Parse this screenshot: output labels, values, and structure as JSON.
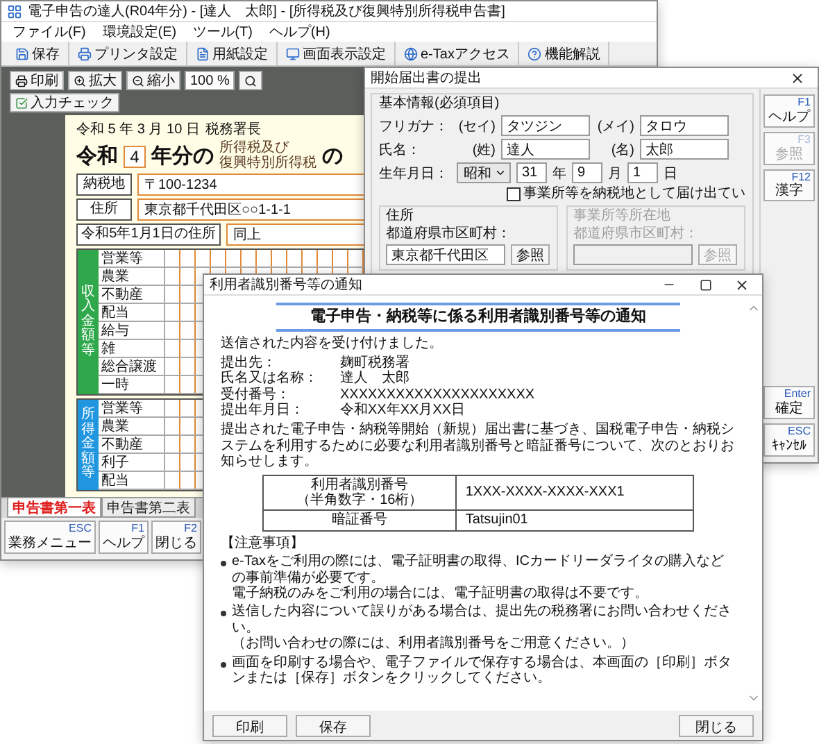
{
  "main_window": {
    "title": "電子申告の達人(R04年分) - [達人　太郎] - [所得税及び復興特別所得税申告書]",
    "menu": [
      "ファイル(F)",
      "環境設定(E)",
      "ツール(T)",
      "ヘルプ(H)"
    ],
    "toolbar": [
      "保存",
      "プリンタ設定",
      "用紙設定",
      "画面表示設定",
      "e-Taxアクセス",
      "機能解説"
    ],
    "view_buttons": [
      "印刷",
      "拡大",
      "縮小"
    ],
    "zoom": "100 %",
    "check_button": "入力チェック",
    "form": {
      "date": "令和 5 年 3 月 10 日",
      "office": "税務署長",
      "era": "令和",
      "year": "4",
      "year_suffix": "年分の",
      "tax_name": [
        "所得税及び",
        "復興特別所得税"
      ],
      "title_end": "の",
      "postal_label": "納税地",
      "postal_code": "〒100-1234",
      "address_label": "住所",
      "address": "東京都千代田区○○1-1-1",
      "prev_label": "令和5年1月1日の住所",
      "prev_address": "同上",
      "sections": [
        {
          "label": "収入金額等",
          "color": "#2ea84a",
          "rows": [
            "営業等",
            "農業",
            "不動産",
            "配当",
            "給与",
            "雑",
            "総合譲渡",
            "一時"
          ]
        },
        {
          "label": "所得金額等",
          "color": "#2196e0",
          "rows": [
            "営業等",
            "農業",
            "不動産",
            "利子",
            "配当"
          ]
        }
      ]
    },
    "sheet_tabs": [
      {
        "label": "申告書第一表",
        "selected": true
      },
      {
        "label": "申告書第二表",
        "selected": false
      }
    ],
    "function_keys": [
      {
        "key": "ESC",
        "label": "業務メニュー"
      },
      {
        "key": "F1",
        "label": "ヘルプ"
      },
      {
        "key": "F2",
        "label": "閉じる"
      }
    ]
  },
  "start_dialog": {
    "title": "開始届出書の提出",
    "section": "基本情報(必須項目)",
    "rows": [
      {
        "label": "フリガナ：",
        "fields": [
          {
            "prefix": "(セイ)",
            "value": "タツジン"
          },
          {
            "prefix": "(メイ)",
            "value": "タロウ"
          }
        ]
      },
      {
        "label": "氏名：",
        "fields": [
          {
            "prefix": "(姓)",
            "value": "達人"
          },
          {
            "prefix": "(名)",
            "value": "太郎"
          }
        ]
      }
    ],
    "birth": {
      "label": "生年月日：",
      "era": "昭和",
      "parts": [
        {
          "value": "31",
          "unit": "年"
        },
        {
          "value": "9",
          "unit": "月"
        },
        {
          "value": "1",
          "unit": "日"
        }
      ]
    },
    "office_checkbox": {
      "label": "事業所等を納税地として届け出てい",
      "checked": false
    },
    "address_groups": [
      {
        "title": "住所",
        "field_label": "都道府県市区町村：",
        "value": "東京都千代田区",
        "button": "参照",
        "disabled": false
      },
      {
        "title": "事業所等所在地",
        "field_label": "都道府県市区町村：",
        "button": "参照",
        "disabled": true
      }
    ],
    "side_keys": [
      {
        "key": "F1",
        "label": "ヘルプ",
        "disabled": false
      },
      {
        "key": "F3",
        "label": "参照",
        "disabled": true
      },
      {
        "key": "F12",
        "label": "漢字",
        "disabled": false
      }
    ],
    "bottom_keys": [
      {
        "key": "Enter",
        "label": "確定",
        "disabled": false
      },
      {
        "key": "ESC",
        "label": "ｷｬﾝｾﾙ",
        "disabled": false
      }
    ]
  },
  "notice_window": {
    "title": "利用者識別番号等の通知",
    "heading": "電子申告・納税等に係る利用者識別番号等の通知",
    "received": "送信された内容を受け付けました。",
    "details": [
      {
        "label": "提出先：",
        "value": "麹町税務署"
      },
      {
        "label": "氏名又は名称：",
        "value": "達人　太郎"
      },
      {
        "label": "受付番号：",
        "value": "XXXXXXXXXXXXXXXXXXXXX"
      },
      {
        "label": "提出年月日：",
        "value": "令和XX年XX月XX日"
      }
    ],
    "intro": "提出された電子申告・納税等開始（新規）届出書に基づき、国税電子申告・納税システムを利用するために必要な利用者識別番号と暗証番号について、次のとおりお知らせします。",
    "id_table": [
      {
        "label": "利用者識別番号",
        "note": "（半角数字・16桁）",
        "value": "1XXX-XXXX-XXXX-XXX1"
      },
      {
        "label": "暗証番号",
        "value": "Tatsujin01"
      }
    ],
    "notes_title": "【注意事項】",
    "notes": [
      [
        "e-Taxをご利用の際には、電子証明書の取得、ICカードリーダライタの購入などの事前準備が必要です。",
        "電子納税のみをご利用の場合には、電子証明書の取得は不要です。"
      ],
      [
        "送信した内容について誤りがある場合は、提出先の税務署にお問い合わせください。",
        "（お問い合わせの際には、利用者識別番号をご用意ください。）"
      ],
      [
        "画面を印刷する場合や、電子ファイルで保存する場合は、本画面の［印刷］ボタンまたは［保存］ボタンをクリックしてください。"
      ]
    ],
    "buttons": [
      "印刷",
      "保存"
    ],
    "close_button": "閉じる"
  }
}
